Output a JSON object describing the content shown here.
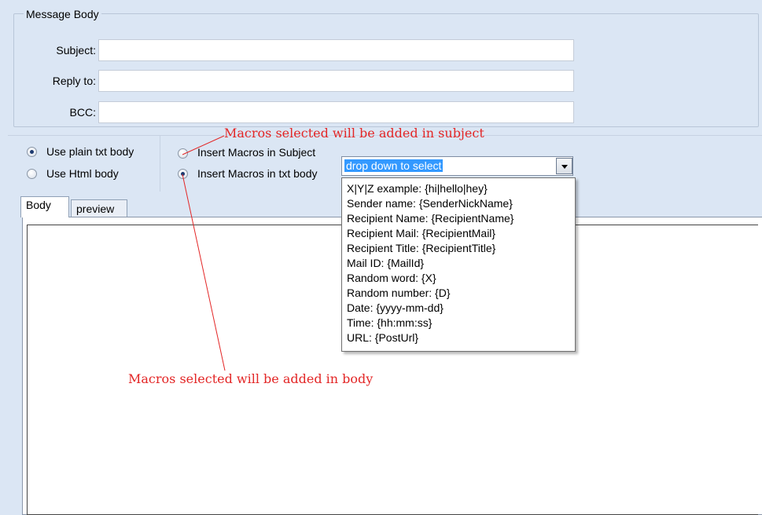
{
  "group": {
    "title": "Message Body"
  },
  "fields": {
    "subject": {
      "label": "Subject:",
      "value": ""
    },
    "reply_to": {
      "label": "Reply to:",
      "value": ""
    },
    "bcc": {
      "label": "BCC:",
      "value": ""
    }
  },
  "body_format": {
    "options": [
      {
        "label": "Use plain txt body",
        "checked": true
      },
      {
        "label": "Use Html body",
        "checked": false
      }
    ]
  },
  "macro_target": {
    "options": [
      {
        "label": "Insert Macros in Subject",
        "checked": false
      },
      {
        "label": "Insert Macros in txt body",
        "checked": true
      }
    ]
  },
  "macro_combo": {
    "selected": "drop down to select",
    "items": [
      "X|Y|Z example: {hi|hello|hey}",
      "Sender name: {SenderNickName}",
      "Recipient Name: {RecipientName}",
      "Recipient Mail: {RecipientMail}",
      "Recipient Title: {RecipientTitle}",
      "Mail ID: {MailId}",
      "Random word: {X}",
      "Random number: {D}",
      "Date: {yyyy-mm-dd}",
      "Time: {hh:mm:ss}",
      "URL: {PostUrl}"
    ]
  },
  "tabs": [
    {
      "label": "Body",
      "active": true
    },
    {
      "label": "preview",
      "active": false
    }
  ],
  "body_text": "",
  "annotations": {
    "subject_note": "Macros selected will be added in subject",
    "body_note": "Macros selected will be added in body",
    "color": "#e32626"
  }
}
